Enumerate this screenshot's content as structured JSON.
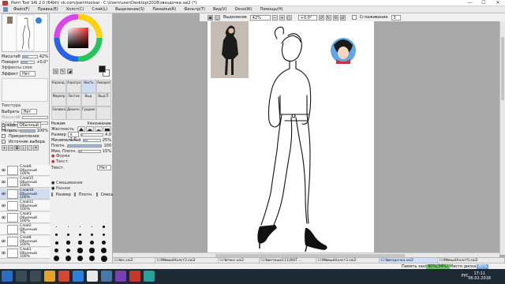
{
  "window": {
    "title": "Paint Tool SAI 2.0 (64bit) vk.com/painttoolsai - C:\\Users\\user\\Desktop\\2018\\звездочка.sai2 (*)",
    "buttons": {
      "minimize": "—",
      "maximize": "☐",
      "close": "✕"
    }
  },
  "menu": [
    "Файл(F)",
    "Правка(E)",
    "Холст(C)",
    "Слой(L)",
    "Выделение(S)",
    "Линейки(R)",
    "Фильтр(T)",
    "Вид(V)",
    "Окно(W)",
    "Помощь(H)"
  ],
  "toolbar": {
    "selection_label": "Выделение",
    "zoom": "42%",
    "angle": "+0,0°",
    "smoothing_label": "Сглаживание",
    "smoothing_value": "3"
  },
  "navigator": {
    "zoom_label": "Масштаб",
    "zoom_value": "42%",
    "angle_label": "Поворот",
    "angle_value": "+0,0°"
  },
  "effects": {
    "header": "Эффекты слоя",
    "effect_label": "Эффект",
    "effect_value": "Нет",
    "texture_header": "Текстура",
    "choose_label": "Выбрать",
    "choose_value": "Нет",
    "scale_label": "Масштаб",
    "strength_label": "Сила",
    "apply_fill": "Применить к заливке"
  },
  "blending": {
    "mode_label": "Режим",
    "mode_value": "Обычный",
    "opacity_label": "Непроз.",
    "opacity_value": "100%",
    "opacity_fraction": 1.0,
    "preserve": "Прикрепление",
    "source": "Источник выбора"
  },
  "layers": [
    {
      "name": "Слой8",
      "mode": "Обычный",
      "opacity": "100%",
      "visible": true,
      "selected": false
    },
    {
      "name": "Слой15",
      "mode": "Обычный",
      "opacity": "100%",
      "visible": true,
      "selected": false
    },
    {
      "name": "Слой10",
      "mode": "Обычный",
      "opacity": "100%",
      "visible": true,
      "selected": true
    },
    {
      "name": "Слой11",
      "mode": "Обычный",
      "opacity": "100%",
      "visible": true,
      "selected": false
    },
    {
      "name": "Слой3",
      "mode": "Обычный",
      "opacity": "100%",
      "visible": true,
      "selected": false
    },
    {
      "name": "Слой2",
      "mode": "Обычный",
      "opacity": "7%",
      "visible": false,
      "selected": false
    },
    {
      "name": "Слой8",
      "mode": "Обычный",
      "opacity": "100%",
      "visible": true,
      "selected": false
    },
    {
      "name": "Слой1",
      "mode": "Обычный",
      "opacity": "100%",
      "visible": true,
      "selected": false
    }
  ],
  "tools": {
    "cells": [
      "Каранд.",
      "Аэрограф",
      "Кисть",
      "Акварель",
      "Маркер",
      "Ластик",
      "Выд.",
      "Выд.П.",
      "Заливка",
      "Двоичн.",
      "Градиент",
      ""
    ],
    "mode_label": "Режим",
    "mode_value": "Умножение",
    "hardness_label": "Жесткость",
    "size_label": "Размер",
    "size_mult": "x 1.0",
    "size_value": "4.0",
    "min_size_label": "Минимальный",
    "min_size_value": "25%",
    "density_label": "Плотн.",
    "density_value": "100",
    "min_density_label": "Мин. Плотн.",
    "min_density_value": "15%",
    "form_header": "Форма",
    "texture_header": "Текст.",
    "texture_sub": "Текст.",
    "texture_value": "Нет",
    "mixing_header": "Смешивание",
    "misc_header": "Разное",
    "checks": [
      "Размер",
      "Плотн.",
      "Смесь"
    ],
    "brush_sizes": [
      "0.6",
      "0.8",
      "1",
      "1.3",
      "1.6",
      "2",
      "2.3",
      "2.6",
      "3",
      "3.5",
      "4",
      "5",
      "6",
      "7",
      "8",
      "9",
      "10",
      "12",
      "14",
      "16",
      "20",
      "25",
      "30",
      "35",
      "40"
    ]
  },
  "colors": {
    "primary": "#1a1a1a",
    "secondary": "#ffffff"
  },
  "tabs": [
    {
      "pct": "33%",
      "name": "arc.sai2"
    },
    {
      "pct": "100%",
      "name": "НовыйХолст2.sai2"
    },
    {
      "pct": "50%",
      "name": "атекс.sai2"
    },
    {
      "pct": "50%",
      "name": "светишо111(ВОТ ..."
    },
    {
      "pct": "100%",
      "name": "НовыйХолст3.sai2"
    },
    {
      "pct": "42%",
      "name": "звездочка.sai2"
    },
    {
      "pct": "100%",
      "name": "НовыйХолст5.sai2"
    }
  ],
  "status": {
    "memory_label": "Память занято",
    "memory_value": "40%(34%)",
    "disk_label": "Место диска",
    "disk_value": "85%"
  },
  "taskbar": {
    "lang": "РУС",
    "time": "17:11",
    "date": "06.02.2018"
  }
}
